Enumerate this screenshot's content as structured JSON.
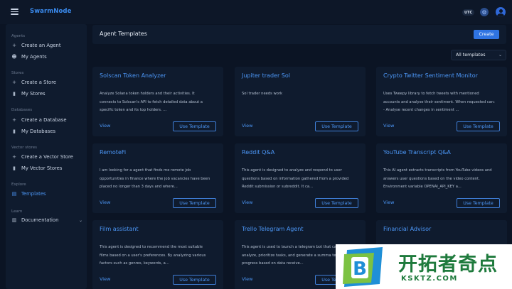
{
  "topbar": {
    "brand": "SwarmNode",
    "timezone": "UTC",
    "icons": [
      "menu-icon",
      "gear-icon",
      "user-avatar-icon"
    ]
  },
  "sidebar": {
    "sections": [
      {
        "label": "Agents",
        "items": [
          {
            "label": "Create an Agent",
            "icon": "plus-icon"
          },
          {
            "label": "My Agents",
            "icon": "robot-icon"
          }
        ]
      },
      {
        "label": "Stores",
        "items": [
          {
            "label": "Create a Store",
            "icon": "plus-icon"
          },
          {
            "label": "My Stores",
            "icon": "database-icon"
          }
        ]
      },
      {
        "label": "Databases",
        "items": [
          {
            "label": "Create a Database",
            "icon": "plus-icon"
          },
          {
            "label": "My Databases",
            "icon": "database-icon"
          }
        ]
      },
      {
        "label": "Vector stores",
        "items": [
          {
            "label": "Create a Vector Store",
            "icon": "plus-icon"
          },
          {
            "label": "My Vector Stores",
            "icon": "database-icon"
          }
        ]
      },
      {
        "label": "Explore",
        "items": [
          {
            "label": "Templates",
            "icon": "templates-icon",
            "active": true
          }
        ]
      },
      {
        "label": "Learn",
        "items": [
          {
            "label": "Documentation",
            "icon": "book-icon"
          }
        ]
      }
    ]
  },
  "header": {
    "title": "Agent Templates",
    "create_label": "Create"
  },
  "filter": {
    "selected": "All templates"
  },
  "card_labels": {
    "view": "View",
    "use": "Use Template"
  },
  "cards": [
    {
      "title": "Solscan Token Analyzer",
      "description": "Analyze Solana token holders and their activities. It connects to Solscan's API to fetch detailed data about a specific token and its top holders. ..."
    },
    {
      "title": "Jupiter trader Sol",
      "description": "Sol trader needs work"
    },
    {
      "title": "Crypto Twitter Sentiment Monitor",
      "description": "Uses Tweepy library to fetch tweets with mentioned accounts and analyse their sentiment. When requested can: - Analyse recent changes in sentiment ..."
    },
    {
      "title": "RemoteFi",
      "description": "I am looking for a agent that finds me remote job opportunities in finance where the job vacancies have been placed no longer than 3 days and where..."
    },
    {
      "title": "Reddit Q&A",
      "description": "This agent is designed to analyze and respond to user questions based on information gathered from a provided Reddit submission or subreddit. It ca..."
    },
    {
      "title": "YouTube Transcript Q&A",
      "description": "This AI agent extracts transcripts from YouTube videos and answers user questions based on the video content. Environment variable OPENAI_API_KEY a..."
    },
    {
      "title": "Film assistant",
      "description": "This agent is designed to recommend the most suitable films based on a user's preferences. By analyzing various factors such as genres, keywords, a..."
    },
    {
      "title": "Trello Telegram Agent",
      "description": "This agent is used to launch a telegram bot that can analyze, prioritize tasks, and generate a summa team's progress based on data receive..."
    },
    {
      "title": "Financial Advisor",
      "description": ""
    }
  ],
  "watermark": {
    "cn": "开拓者奇点",
    "en": "KSKTZ.COM"
  }
}
